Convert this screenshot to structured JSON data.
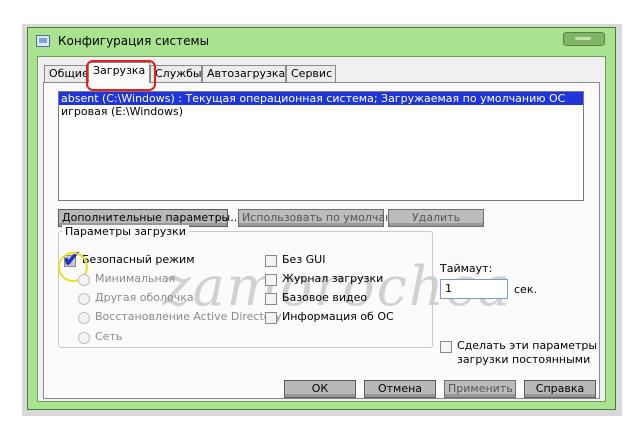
{
  "window": {
    "title": "Конфигурация системы"
  },
  "tabs": [
    {
      "label": "Общие"
    },
    {
      "label": "Загрузка"
    },
    {
      "label": "Службы"
    },
    {
      "label": "Автозагрузка"
    },
    {
      "label": "Сервис"
    }
  ],
  "os_list": {
    "items": [
      {
        "label": "absent (C:\\Windows) : Текущая операционная система; Загружаемая по умолчанию ОС"
      },
      {
        "label": "игровая (E:\\Windows)"
      }
    ]
  },
  "list_buttons": {
    "advanced": "Дополнительные параметры...",
    "set_default": "Использовать по умолчанию",
    "delete": "Удалить"
  },
  "boot_options": {
    "title": "Параметры загрузки",
    "safe_boot": "Безопасный режим",
    "minimal": "Минимальная",
    "alternate_shell": "Другая оболочка",
    "ad_repair": "Восстановление Active Directory",
    "network": "Сеть",
    "no_gui": "Без GUI",
    "boot_log": "Журнал загрузки",
    "base_video": "Базовое видео",
    "os_info": "Информация  об ОС"
  },
  "timeout": {
    "label": "Таймаут:",
    "value": "1",
    "unit": "сек."
  },
  "make_permanent": {
    "line1": "Сделать эти параметры",
    "line2": "загрузки постоянными"
  },
  "footer": {
    "ok": "ОК",
    "cancel": "Отмена",
    "apply": "Применить",
    "help": "Справка"
  },
  "watermark": "zamorochca",
  "colors": {
    "window_frame": "#a9e38f",
    "selection": "#1f35d8",
    "tab_highlight": "#e02020",
    "checkbox_highlight": "#e8e020",
    "checkmark": "#1e34c8"
  }
}
